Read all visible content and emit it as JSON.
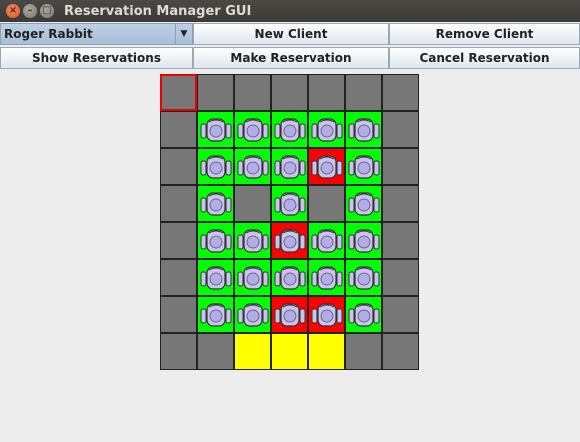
{
  "window": {
    "title": "Reservation Manager GUI"
  },
  "toolbar": {
    "client_select": "Roger Rabbit",
    "new_client": "New Client",
    "remove_client": "Remove Client",
    "show_reservations": "Show Reservations",
    "make_reservation": "Make Reservation",
    "cancel_reservation": "Cancel Reservation"
  },
  "seat_map": {
    "rows": [
      [
        "empty",
        "empty",
        "empty",
        "empty",
        "empty",
        "empty",
        "empty"
      ],
      [
        "empty",
        "free",
        "free",
        "free",
        "free",
        "free",
        "empty"
      ],
      [
        "empty",
        "free",
        "free",
        "free",
        "reserved",
        "free",
        "empty"
      ],
      [
        "empty",
        "free",
        "empty",
        "free",
        "empty",
        "free",
        "empty"
      ],
      [
        "empty",
        "free",
        "free",
        "reserved",
        "free",
        "free",
        "empty"
      ],
      [
        "empty",
        "free",
        "free",
        "free",
        "free",
        "free",
        "empty"
      ],
      [
        "empty",
        "free",
        "free",
        "reserved",
        "reserved",
        "free",
        "empty"
      ],
      [
        "empty",
        "empty",
        "stage",
        "stage",
        "stage",
        "empty",
        "empty"
      ]
    ],
    "selected": [
      0,
      0
    ],
    "colors": {
      "empty": "#777777",
      "free": "#00ff00",
      "reserved": "#ff0000",
      "stage": "#ffff00"
    }
  }
}
